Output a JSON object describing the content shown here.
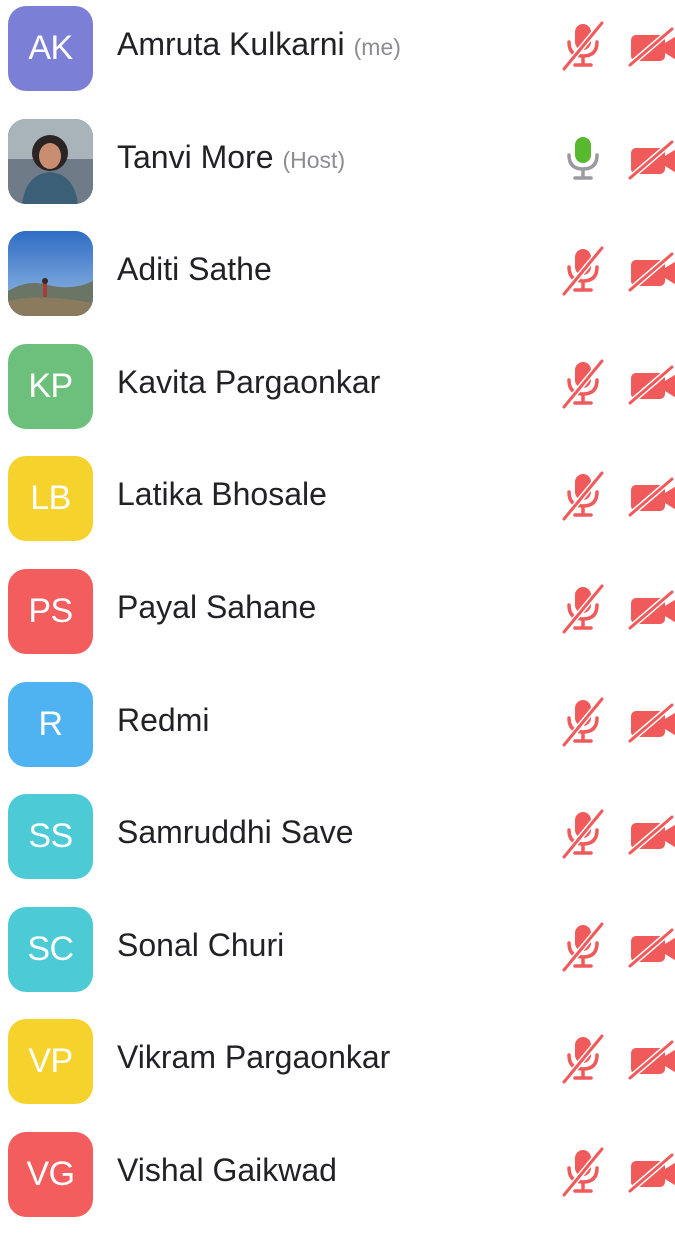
{
  "participants": [
    {
      "initials": "AK",
      "name": "Amruta Kulkarni",
      "tag": "(me)",
      "avatar_color": "#7b80d6",
      "avatar_icon": "initials-avatar",
      "mic": "muted",
      "video": "off"
    },
    {
      "initials": "",
      "name": "Tanvi More",
      "tag": "(Host)",
      "avatar_color": "#5a6a78",
      "avatar_icon": "photo-avatar",
      "mic": "on",
      "video": "off"
    },
    {
      "initials": "",
      "name": "Aditi Sathe",
      "tag": "",
      "avatar_color": "#4a78c2",
      "avatar_icon": "landscape-photo-avatar",
      "mic": "muted",
      "video": "off"
    },
    {
      "initials": "KP",
      "name": "Kavita Pargaonkar",
      "tag": "",
      "avatar_color": "#6dc07b",
      "avatar_icon": "initials-avatar",
      "mic": "muted",
      "video": "off"
    },
    {
      "initials": "LB",
      "name": "Latika Bhosale",
      "tag": "",
      "avatar_color": "#f6d22d",
      "avatar_icon": "initials-avatar",
      "mic": "muted",
      "video": "off"
    },
    {
      "initials": "PS",
      "name": "Payal Sahane",
      "tag": "",
      "avatar_color": "#f45d5d",
      "avatar_icon": "initials-avatar",
      "mic": "muted",
      "video": "off"
    },
    {
      "initials": "R",
      "name": "Redmi",
      "tag": "",
      "avatar_color": "#4fb3f2",
      "avatar_icon": "initials-avatar",
      "mic": "muted",
      "video": "off"
    },
    {
      "initials": "SS",
      "name": "Samruddhi Save",
      "tag": "",
      "avatar_color": "#4ccad6",
      "avatar_icon": "initials-avatar",
      "mic": "muted",
      "video": "off"
    },
    {
      "initials": "SC",
      "name": "Sonal Churi",
      "tag": "",
      "avatar_color": "#4ccad6",
      "avatar_icon": "initials-avatar",
      "mic": "muted",
      "video": "off"
    },
    {
      "initials": "VP",
      "name": "Vikram Pargaonkar",
      "tag": "",
      "avatar_color": "#f6d22d",
      "avatar_icon": "initials-avatar",
      "mic": "muted",
      "video": "off"
    },
    {
      "initials": "VG",
      "name": "Vishal Gaikwad",
      "tag": "",
      "avatar_color": "#f45d5d",
      "avatar_icon": "initials-avatar",
      "mic": "muted",
      "video": "off"
    }
  ],
  "colors": {
    "muted": "#f05a5a",
    "mic_on_body": "#58b92e",
    "mic_on_stand": "#9a9aa0",
    "video_off": "#f05a5a"
  }
}
